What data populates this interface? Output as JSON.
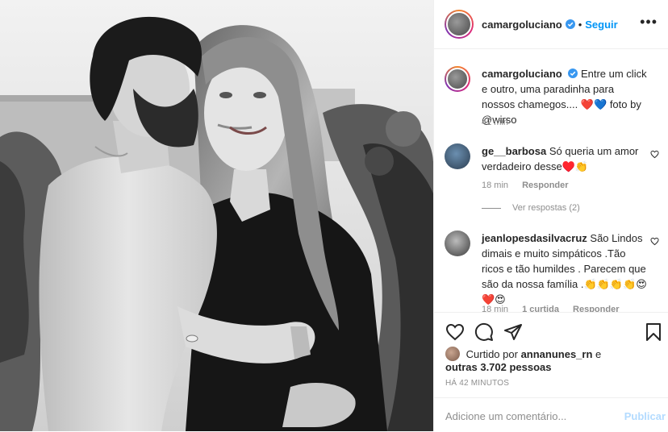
{
  "header": {
    "username": "camargoluciano",
    "dot": "•",
    "follow_label": "Seguir"
  },
  "caption": {
    "username": "camargoluciano",
    "text": "Entre um click e outro, uma paradinha para nossos chamegos.... ❤️💙 foto by @wirso",
    "time": "42 min"
  },
  "comments": [
    {
      "username": "ge__barbosa",
      "text": "Só queria um amor verdadeiro desse♥️👏",
      "time": "18 min",
      "reply_label": "Responder",
      "view_replies": "Ver respostas (2)"
    },
    {
      "username": "jeanlopesdasilvacruz",
      "text": "São Lindos dimais e muito simpáticos .Tão ricos e tão humildes . Parecem que são da nossa família .👏👏👏👏😍❤️😍",
      "time": "18 min",
      "likes": "1 curtida",
      "reply_label": "Responder"
    }
  ],
  "likes": {
    "prefix": "Curtido por",
    "user": "annanunes_rn",
    "conj": "e",
    "others": "outras 3.702 pessoas"
  },
  "timestamp": "HÁ 42 MINUTOS",
  "add_comment": {
    "placeholder": "Adicione um comentário...",
    "publish_label": "Publicar"
  },
  "colors": {
    "accent": "#0095f6",
    "link": "#00376b",
    "muted": "#8e8e8e",
    "publish_disabled": "#b3dbff"
  },
  "icons": [
    "verified-icon",
    "more-options-icon",
    "heart-icon",
    "comment-icon",
    "share-icon",
    "bookmark-icon"
  ]
}
